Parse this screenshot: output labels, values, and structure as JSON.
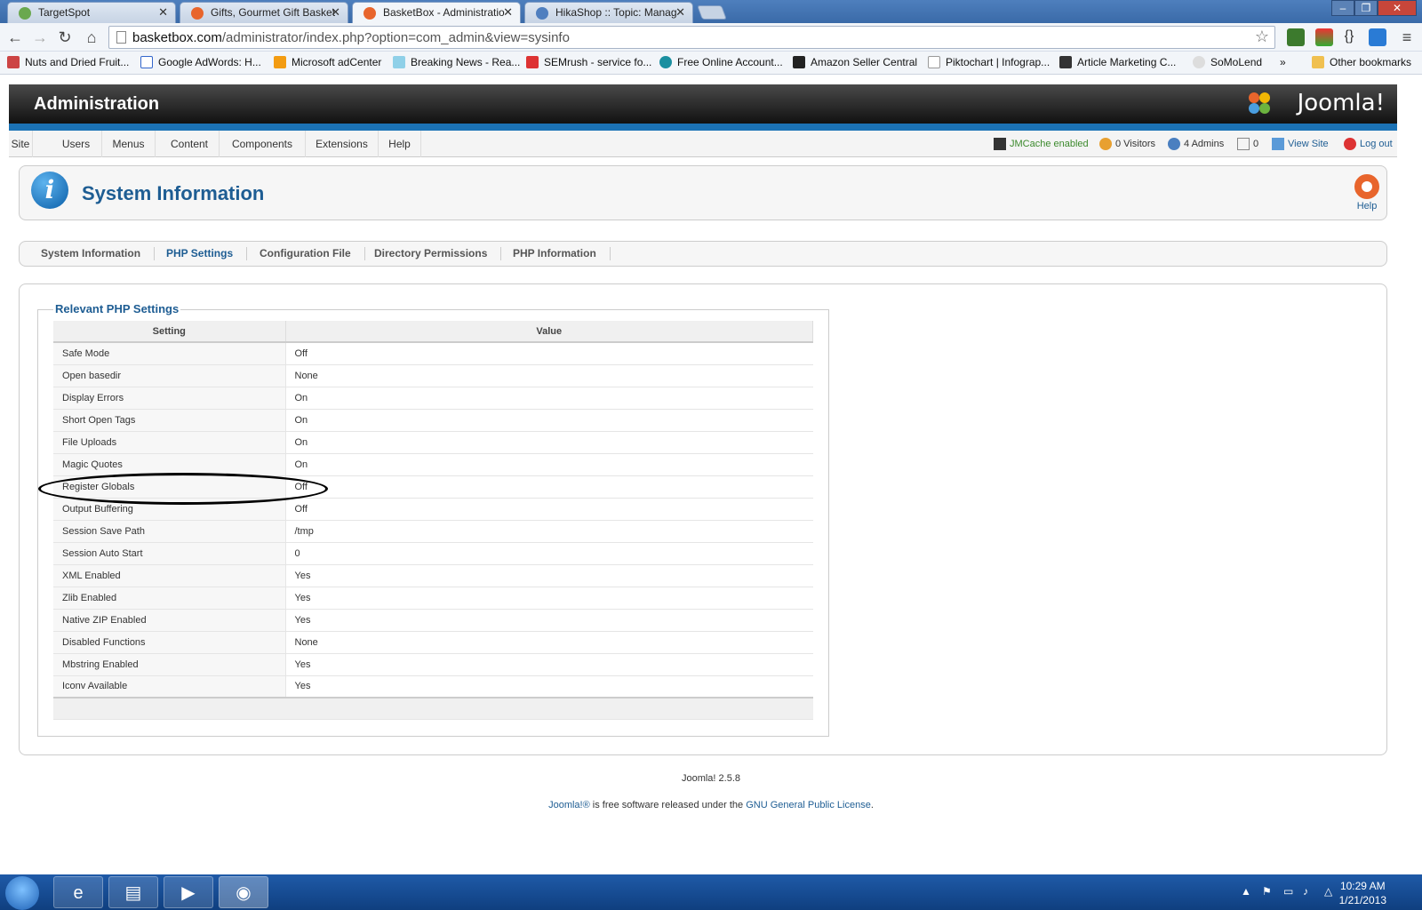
{
  "browser": {
    "tabs": [
      {
        "title": "TargetSpot",
        "color": "#6aa84f"
      },
      {
        "title": "Gifts, Gourmet Gift Basket",
        "color": "#e8652c"
      },
      {
        "title": "BasketBox - Administratio",
        "color": "#e8652c"
      },
      {
        "title": "HikaShop :: Topic: Manag",
        "color": "#4f7fbf"
      }
    ],
    "url_host": "basketbox.com",
    "url_path": "/administrator/index.php?option=com_admin&view=sysinfo",
    "bookmarks": [
      "Nuts and Dried Fruit...",
      "Google AdWords: H...",
      "Microsoft adCenter",
      "Breaking News - Rea...",
      "SEMrush - service fo...",
      "Free Online Account...",
      "Amazon Seller Central",
      "Piktochart | Infograp...",
      "Article Marketing C...",
      "SoMoLend"
    ],
    "other_bookmarks": "Other bookmarks",
    "chevron": "»"
  },
  "admin": {
    "header_title": "Administration",
    "logo_text": "Joomla!",
    "menu": [
      "Site",
      "Users",
      "Menus",
      "Content",
      "Components",
      "Extensions",
      "Help"
    ],
    "status": {
      "cache": "JMCache enabled",
      "visitors": "0 Visitors",
      "admins": "4 Admins",
      "messages": "0",
      "view_site": "View Site",
      "logout": "Log out"
    },
    "page_title": "System Information",
    "help_label": "Help",
    "subtabs": [
      "System Information",
      "PHP Settings",
      "Configuration File",
      "Directory Permissions",
      "PHP Information"
    ],
    "active_subtab": "PHP Settings"
  },
  "php_settings": {
    "legend": "Relevant PHP Settings",
    "col_setting": "Setting",
    "col_value": "Value",
    "rows": [
      {
        "setting": "Safe Mode",
        "value": "Off"
      },
      {
        "setting": "Open basedir",
        "value": "None"
      },
      {
        "setting": "Display Errors",
        "value": "On"
      },
      {
        "setting": "Short Open Tags",
        "value": "On"
      },
      {
        "setting": "File Uploads",
        "value": "On"
      },
      {
        "setting": "Magic Quotes",
        "value": "On"
      },
      {
        "setting": "Register Globals",
        "value": "Off"
      },
      {
        "setting": "Output Buffering",
        "value": "Off"
      },
      {
        "setting": "Session Save Path",
        "value": "/tmp"
      },
      {
        "setting": "Session Auto Start",
        "value": "0"
      },
      {
        "setting": "XML Enabled",
        "value": "Yes"
      },
      {
        "setting": "Zlib Enabled",
        "value": "Yes"
      },
      {
        "setting": "Native ZIP Enabled",
        "value": "Yes"
      },
      {
        "setting": "Disabled Functions",
        "value": "None"
      },
      {
        "setting": "Mbstring Enabled",
        "value": "Yes"
      },
      {
        "setting": "Iconv Available",
        "value": "Yes"
      }
    ],
    "highlighted_row": "Register Globals"
  },
  "footer": {
    "version": "Joomla! 2.5.8",
    "license_prefix": "Joomla!®",
    "license_middle": " is free software released under the ",
    "license_link": "GNU General Public License",
    "license_suffix": "."
  },
  "taskbar": {
    "time": "10:29 AM",
    "date": "1/21/2013"
  },
  "colors": {
    "brand_blue": "#1e5d93",
    "joomla_bar": "#1b72b5"
  }
}
